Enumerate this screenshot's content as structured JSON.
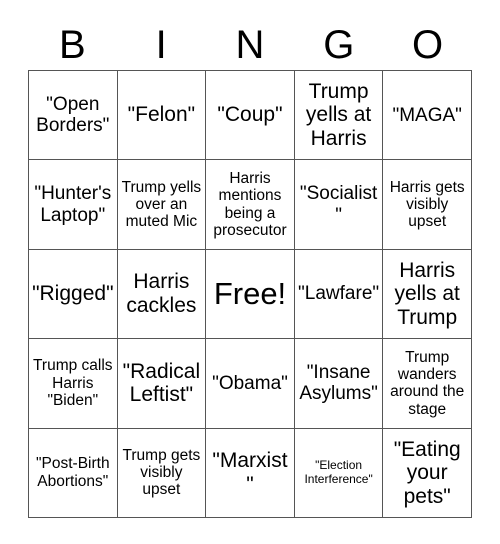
{
  "card": {
    "header_letters": [
      "B",
      "I",
      "N",
      "G",
      "O"
    ],
    "columns": [
      {
        "letter": "B",
        "cells": [
          {
            "text": "\"Open Borders\"",
            "size": "md"
          },
          {
            "text": "\"Hunter's Laptop\"",
            "size": "md"
          },
          {
            "text": "\"Rigged\"",
            "size": "lg"
          },
          {
            "text": "Trump calls Harris \"Biden\"",
            "size": "sm"
          },
          {
            "text": "\"Post-Birth Abortions\"",
            "size": "sm"
          }
        ]
      },
      {
        "letter": "I",
        "cells": [
          {
            "text": "\"Felon\"",
            "size": "lg"
          },
          {
            "text": "Trump yells over an muted Mic",
            "size": "sm"
          },
          {
            "text": "Harris cackles",
            "size": "lg"
          },
          {
            "text": "\"Radical Leftist\"",
            "size": "lg"
          },
          {
            "text": "Trump gets visibly upset",
            "size": "sm"
          }
        ]
      },
      {
        "letter": "N",
        "cells": [
          {
            "text": "\"Coup\"",
            "size": "lg"
          },
          {
            "text": "Harris mentions being a prosecutor",
            "size": "sm"
          },
          {
            "text": "Free!",
            "size": "xl"
          },
          {
            "text": "\"Obama\"",
            "size": "md"
          },
          {
            "text": "\"Marxist\"",
            "size": "lg"
          }
        ]
      },
      {
        "letter": "G",
        "cells": [
          {
            "text": "Trump yells at Harris",
            "size": "lg"
          },
          {
            "text": "\"Socialist\"",
            "size": "md"
          },
          {
            "text": "\"Lawfare\"",
            "size": "md"
          },
          {
            "text": "\"Insane Asylums\"",
            "size": "md"
          },
          {
            "text": "\"Election Interference\"",
            "size": "xs"
          }
        ]
      },
      {
        "letter": "O",
        "cells": [
          {
            "text": "\"MAGA\"",
            "size": "md"
          },
          {
            "text": "Harris gets visibly upset",
            "size": "sm"
          },
          {
            "text": "Harris yells at Trump",
            "size": "lg"
          },
          {
            "text": "Trump wanders around the stage",
            "size": "sm"
          },
          {
            "text": "\"Eating your pets\"",
            "size": "lg"
          }
        ]
      }
    ]
  }
}
